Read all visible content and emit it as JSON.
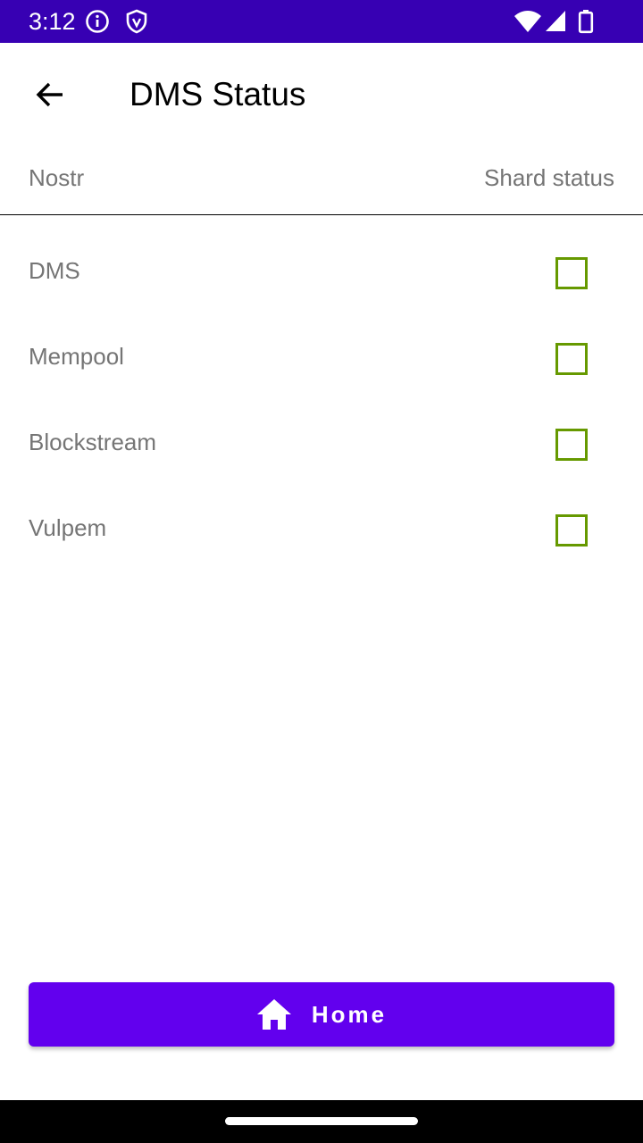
{
  "status_bar": {
    "time": "3:12",
    "background_color": "#3700b3",
    "icons": [
      "info-icon",
      "shield-icon",
      "wifi-icon",
      "signal-icon",
      "battery-icon"
    ]
  },
  "app_bar": {
    "title": "DMS Status",
    "back_icon": "arrow-back-icon"
  },
  "table": {
    "header_left": "Nostr",
    "header_right": "Shard status",
    "rows": [
      {
        "label": "DMS",
        "checked": false
      },
      {
        "label": "Mempool",
        "checked": false
      },
      {
        "label": "Blockstream",
        "checked": false
      },
      {
        "label": "Vulpem",
        "checked": false
      }
    ],
    "checkbox_color": "#669900"
  },
  "home_button": {
    "label": "Home",
    "icon": "home-icon",
    "color": "#6200ee"
  }
}
